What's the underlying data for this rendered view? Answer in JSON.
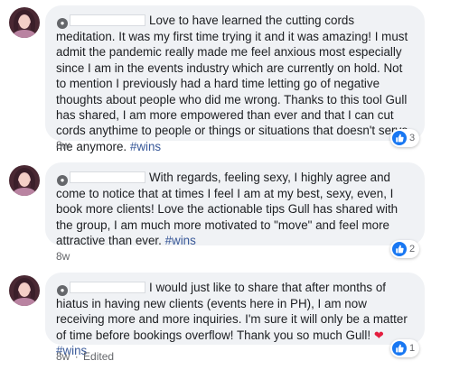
{
  "comments": [
    {
      "text_parts": [
        "Love to have learned the cutting cords meditation. It was my first time trying it and it was amazing! I must admit the pandemic really made me feel anxious most especially since I am in the events industry which are currently on hold. Not to mention I previously had a hard time letting go of negative thoughts about people who did me wrong. Thanks to this tool Gull has shared, I am more empowered than ever and that I can cut cords anythime to people or things or situations that doesn't serve me anymore. "
      ],
      "hashtag": "#wins",
      "reaction_count": "3",
      "time": "8w",
      "edited": ""
    },
    {
      "text_parts": [
        "With regards, feeling sexy, I highly agree and come to notice that at times I feel I am at my best, sexy, even, I book more clients! Love the actionable tips Gull has shared with the group, I am much more motivated to \"move\" and feel more attractive than ever. "
      ],
      "hashtag": "#wins",
      "reaction_count": "2",
      "time": "8w",
      "edited": ""
    },
    {
      "text_parts": [
        "I would just like to share that after months of hiatus in having new clients (events here in PH), I am now receiving more and more inquiries. I'm sure it will only be a matter of time before bookings overflow! Thank you so much Gull! "
      ],
      "heart": "❤",
      "hashtag": "#wins",
      "reaction_count": "1",
      "time": "8w",
      "separator": "·",
      "edited": "Edited"
    }
  ],
  "colors": {
    "bubble": "#f0f2f5",
    "hashtag": "#385898",
    "like": "#1877f2",
    "meta": "#65676b"
  }
}
